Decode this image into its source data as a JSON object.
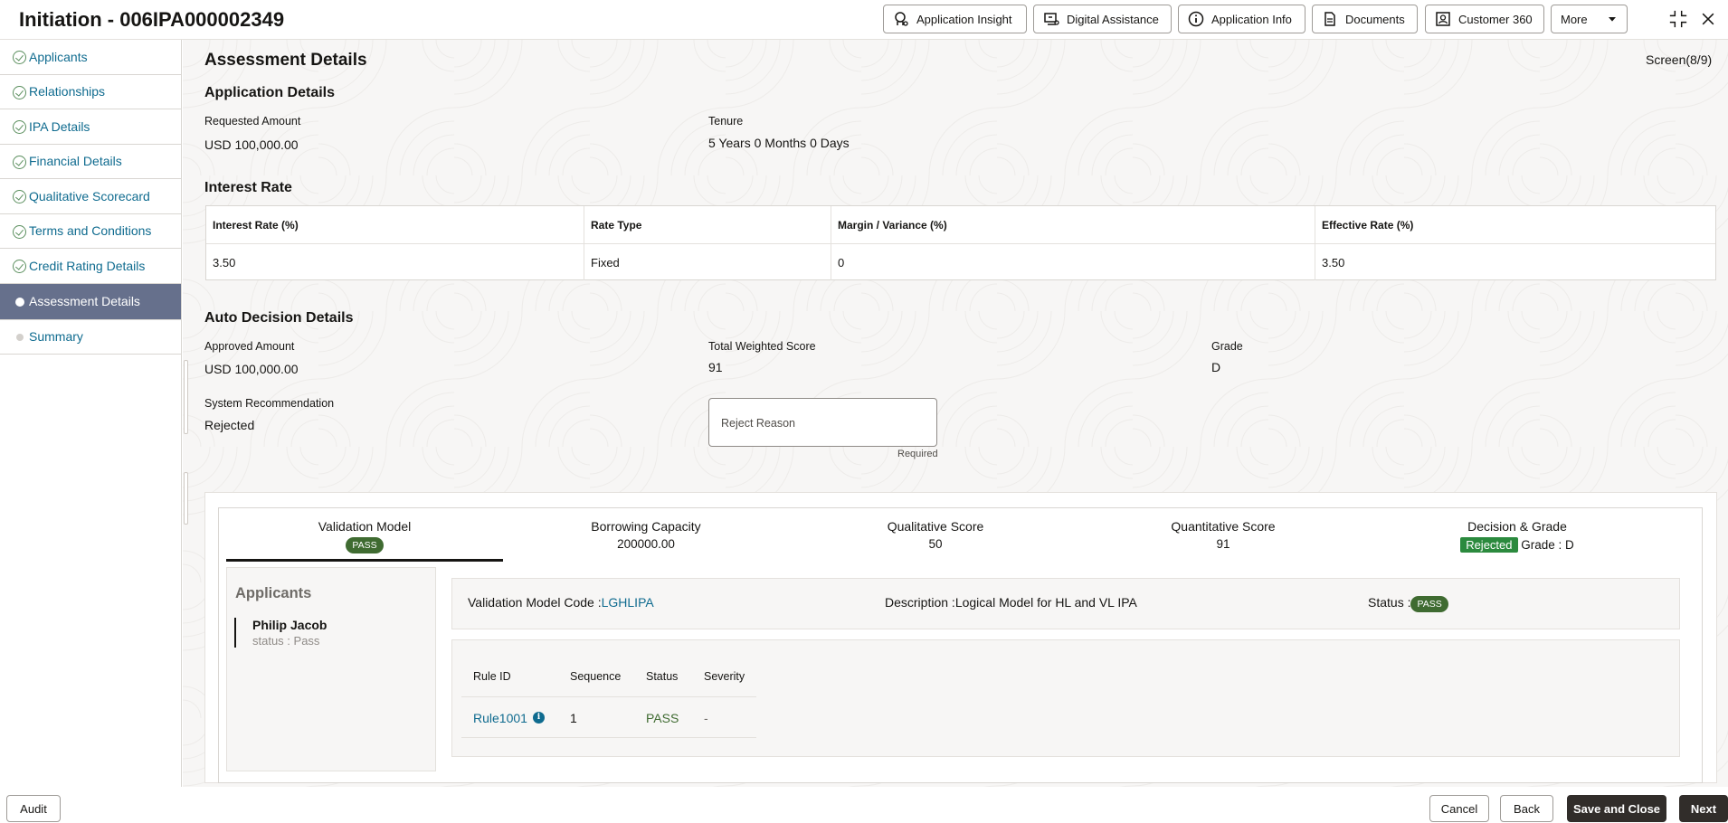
{
  "header": {
    "title": "Initiation - 006IPA000002349",
    "buttons": {
      "insight": "Application Insight",
      "assistance": "Digital Assistance",
      "info": "Application Info",
      "documents": "Documents",
      "customer": "Customer 360",
      "more": "More"
    }
  },
  "sidebar": {
    "items": [
      {
        "label": "Applicants",
        "state": "done"
      },
      {
        "label": "Relationships",
        "state": "done"
      },
      {
        "label": "IPA Details",
        "state": "done"
      },
      {
        "label": "Financial Details",
        "state": "done"
      },
      {
        "label": "Qualitative Scorecard",
        "state": "done"
      },
      {
        "label": "Terms and Conditions",
        "state": "done"
      },
      {
        "label": "Credit Rating Details",
        "state": "done"
      },
      {
        "label": "Assessment Details",
        "state": "active"
      },
      {
        "label": "Summary",
        "state": "pending"
      }
    ]
  },
  "page": {
    "title": "Assessment Details",
    "screen": "Screen(8/9)"
  },
  "application_details": {
    "heading": "Application Details",
    "requested_amount_label": "Requested Amount",
    "requested_amount": "USD 100,000.00",
    "tenure_label": "Tenure",
    "tenure": "5 Years 0 Months 0 Days"
  },
  "interest_rate": {
    "heading": "Interest Rate",
    "columns": [
      "Interest Rate (%)",
      "Rate Type",
      "Margin / Variance (%)",
      "Effective Rate (%)"
    ],
    "row": [
      "3.50",
      "Fixed",
      "0",
      "3.50"
    ]
  },
  "auto_decision": {
    "heading": "Auto Decision Details",
    "approved_amount_label": "Approved Amount",
    "approved_amount": "USD 100,000.00",
    "score_label": "Total Weighted Score",
    "score": "91",
    "grade_label": "Grade",
    "grade": "D",
    "recommendation_label": "System Recommendation",
    "recommendation": "Rejected",
    "reject_reason_placeholder": "Reject Reason",
    "required_text": "Required"
  },
  "tabs": {
    "validation": {
      "label": "Validation Model",
      "badge": "PASS"
    },
    "borrowing": {
      "label": "Borrowing Capacity",
      "value": "200000.00"
    },
    "qualitative": {
      "label": "Qualitative Score",
      "value": "50"
    },
    "quantitative": {
      "label": "Quantitative Score",
      "value": "91"
    },
    "decision": {
      "label": "Decision & Grade",
      "badge": "Rejected",
      "grade": "Grade : D"
    }
  },
  "applicants_panel": {
    "heading": "Applicants",
    "name": "Philip Jacob",
    "status": "status : Pass"
  },
  "validation_model": {
    "code_label": "Validation Model Code :",
    "code": "LGHLIPA",
    "description_label": "Description :",
    "description": "Logical Model for HL and VL IPA",
    "status_label": "Status :",
    "status": "PASS"
  },
  "rules": {
    "columns": [
      "Rule ID",
      "Sequence",
      "Status",
      "Severity"
    ],
    "row": {
      "rule_id": "Rule1001",
      "sequence": "1",
      "status": "PASS",
      "severity": "-"
    }
  },
  "footer": {
    "audit": "Audit",
    "cancel": "Cancel",
    "back": "Back",
    "save_close": "Save and Close",
    "next": "Next"
  },
  "colors": {
    "link": "#0f6b8f",
    "active_nav": "#66708c",
    "pass_badge": "#3f6b31",
    "rejected_badge": "#2b8a3e",
    "primary_button": "#312d2a"
  }
}
